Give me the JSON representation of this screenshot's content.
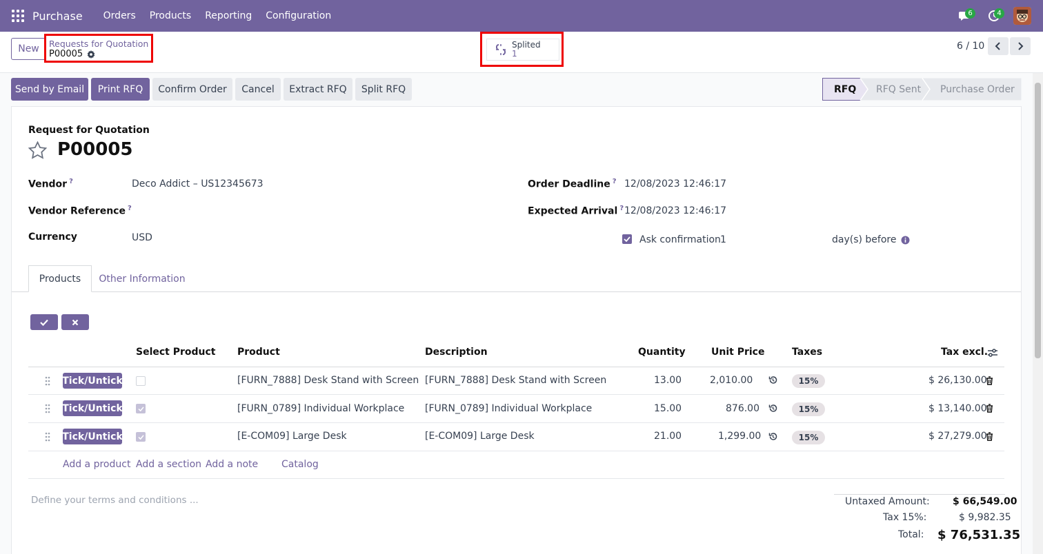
{
  "navbar": {
    "app_name": "Purchase",
    "menu": [
      "Orders",
      "Products",
      "Reporting",
      "Configuration"
    ],
    "messages_count": "6",
    "activities_count": "4"
  },
  "control_panel": {
    "new_label": "New",
    "breadcrumb_parent": "Requests for Quotation",
    "breadcrumb_current": "P00005",
    "smart_button_label": "Splited",
    "smart_button_count": "1",
    "pager": "6 / 10"
  },
  "actions": {
    "send_email": "Send by Email",
    "print_rfq": "Print RFQ",
    "confirm_order": "Confirm Order",
    "cancel": "Cancel",
    "extract_rfq": "Extract RFQ",
    "split_rfq": "Split RFQ"
  },
  "stages": [
    "RFQ",
    "RFQ Sent",
    "Purchase Order"
  ],
  "form": {
    "doc_type": "Request for Quotation",
    "doc_name": "P00005",
    "vendor_label": "Vendor",
    "vendor_value": "Deco Addict – US12345673",
    "vendor_ref_label": "Vendor Reference",
    "currency_label": "Currency",
    "currency_value": "USD",
    "order_deadline_label": "Order Deadline",
    "order_deadline_value": "12/08/2023 12:46:17",
    "expected_arrival_label": "Expected Arrival",
    "expected_arrival_value": "12/08/2023 12:46:17",
    "ask_confirmation_label": "Ask confirmation",
    "ask_confirmation_days": "1",
    "days_before_label": "day(s) before"
  },
  "tabs": [
    "Products",
    "Other Information"
  ],
  "table": {
    "headers": {
      "select_product": "Select Product",
      "product": "Product",
      "description": "Description",
      "quantity": "Quantity",
      "unit_price": "Unit Price",
      "taxes": "Taxes",
      "tax_excl": "Tax excl."
    },
    "tick_label": "Tick/Untick",
    "rows": [
      {
        "product": "[FURN_7888] Desk Stand with Screen",
        "description": "[FURN_7888] Desk Stand with Screen",
        "quantity": "13.00",
        "unit_price": "2,010.00",
        "tax": "15%",
        "subtotal": "$ 26,130.00"
      },
      {
        "product": "[FURN_0789] Individual Workplace",
        "description": "[FURN_0789] Individual Workplace",
        "quantity": "15.00",
        "unit_price": "876.00",
        "tax": "15%",
        "subtotal": "$ 13,140.00"
      },
      {
        "product": "[E-COM09] Large Desk",
        "description": "[E-COM09] Large Desk",
        "quantity": "21.00",
        "unit_price": "1,299.00",
        "tax": "15%",
        "subtotal": "$ 27,279.00"
      }
    ],
    "add_product": "Add a product",
    "add_section": "Add a section",
    "add_note": "Add a note",
    "catalog": "Catalog"
  },
  "terms_placeholder": "Define your terms and conditions ...",
  "totals": {
    "untaxed_label": "Untaxed Amount:",
    "untaxed_value": "$ 66,549.00",
    "tax_label": "Tax 15%:",
    "tax_value": "$ 9,982.35",
    "total_label": "Total:",
    "total_value": "$ 76,531.35"
  },
  "colors": {
    "brand": "#71639e",
    "highlight": "#e00000",
    "badge": "#28a745"
  }
}
